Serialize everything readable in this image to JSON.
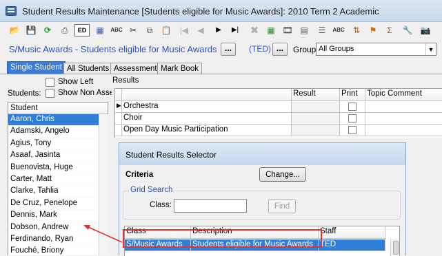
{
  "window": {
    "title": "Student Results Maintenance  [Students eligible for Music Awards]:  2010 Term 2 Academic"
  },
  "toolbar": {
    "icons": [
      "open-icon",
      "save-icon",
      "refresh-icon",
      "print-icon",
      "edit-icon",
      "calculator-icon",
      "spellcheck-icon",
      "cut-icon",
      "copy-icon",
      "paste-icon",
      "first-icon",
      "previous-icon",
      "next-icon",
      "last-icon",
      "delete-icon",
      "grid-icon",
      "film-icon",
      "calendar-icon",
      "spellcheck-icon",
      "sort-icon",
      "flag-icon",
      "sigma-icon",
      "tools-icon",
      "camera-icon"
    ],
    "edit_label": "ED"
  },
  "header": {
    "context": "S/Music Awards - Students eligible for Music Awards",
    "browse_label": "...",
    "staff": "(TED)",
    "staff_browse_label": "...",
    "group_label": "Group:",
    "group_value": "All Groups"
  },
  "tabs": [
    {
      "label": "Single Student",
      "active": true
    },
    {
      "label": "All Students",
      "active": false
    },
    {
      "label": "Assessment",
      "active": false
    },
    {
      "label": "Mark Book",
      "active": false
    }
  ],
  "left_panel": {
    "show_left_label": "Show Left",
    "students_label": "Students:",
    "show_non_assessed_label": "Show Non Asses",
    "column_header": "Student",
    "students": [
      "Aaron, Chris",
      "Adamski, Angelo",
      "Agius, Tony",
      "Asaaf, Jasinta",
      "Buenovista, Huge",
      "Carter, Matt",
      "Clarke, Tahlia",
      "De Cruz, Penelope",
      "Dennis, Mark",
      "Dobson, Andrew",
      "Ferdinando, Ryan",
      "Fouché, Briony"
    ],
    "selected_index": 0
  },
  "results": {
    "label": "Results",
    "columns": [
      "",
      "Result",
      "Print",
      "Topic Comment"
    ],
    "rows": [
      "Orchestra",
      "Choir",
      "Open Day Music Participation"
    ]
  },
  "dialog": {
    "title": "Student Results Selector",
    "criteria_label": "Criteria",
    "change_button": "Change...",
    "grid_search_label": "Grid Search",
    "class_label": "Class:",
    "class_value": "",
    "find_button": "Find",
    "columns": [
      "Class",
      "Description",
      "Staff"
    ],
    "rows": [
      {
        "class": "S/Music Awards",
        "description": "Students eligible for Music Awards",
        "staff": "TED"
      }
    ]
  },
  "colors": {
    "accent": "#2a52be",
    "selection": "#2f7fd8",
    "highlight": "#e53030"
  }
}
